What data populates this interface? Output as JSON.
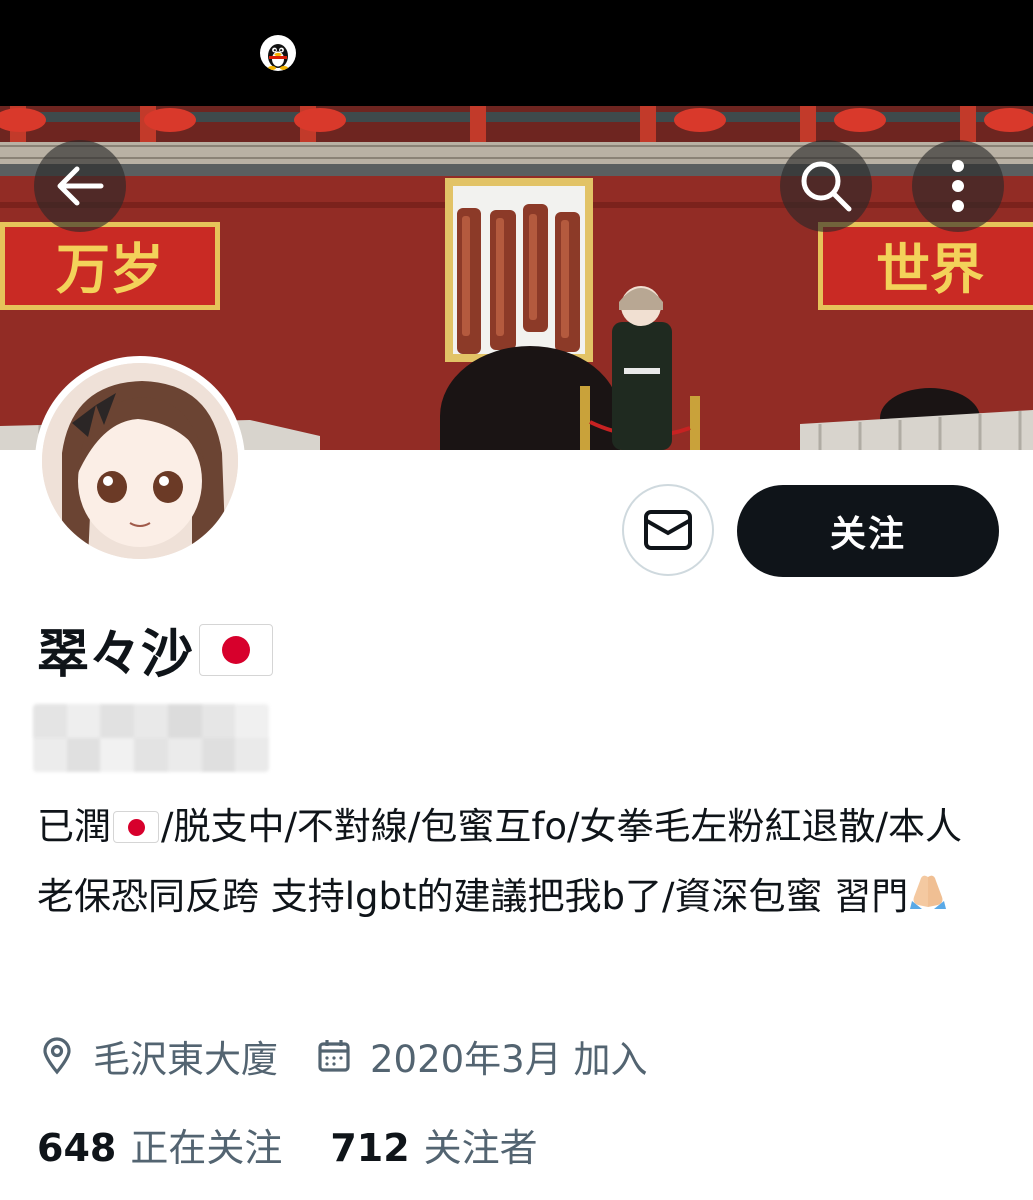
{
  "status_bar": {
    "notification_icon": "qq-penguin-icon"
  },
  "header": {
    "back_icon": "arrow-left-icon",
    "search_icon": "search-icon",
    "more_icon": "more-vertical-icon",
    "banner_text_left": "万岁",
    "banner_text_right": "世界"
  },
  "profile": {
    "display_name": "翠々沙",
    "name_flag": "jp-flag-icon",
    "handle": "",
    "bio": {
      "part1": "已潤",
      "part2": "/脱支中/不對線/包蜜互fo/女拳毛左粉紅退散/本人老保恐同反跨 支持lgbt的建議把我b了/資深包蜜 習門",
      "emoji_flag": "jp-flag-icon",
      "emoji_end": "folded-hands-icon"
    },
    "location": "毛沢東大廈",
    "joined": "2020年3月 加入",
    "following_count": "648",
    "following_label": "正在关注",
    "followers_count": "712",
    "followers_label": "关注者"
  },
  "actions": {
    "message_icon": "mail-icon",
    "follow_label": "关注"
  },
  "colors": {
    "text_primary": "#0f1419",
    "text_secondary": "#536471",
    "follow_bg": "#0f1419",
    "border": "#cfd9de"
  }
}
